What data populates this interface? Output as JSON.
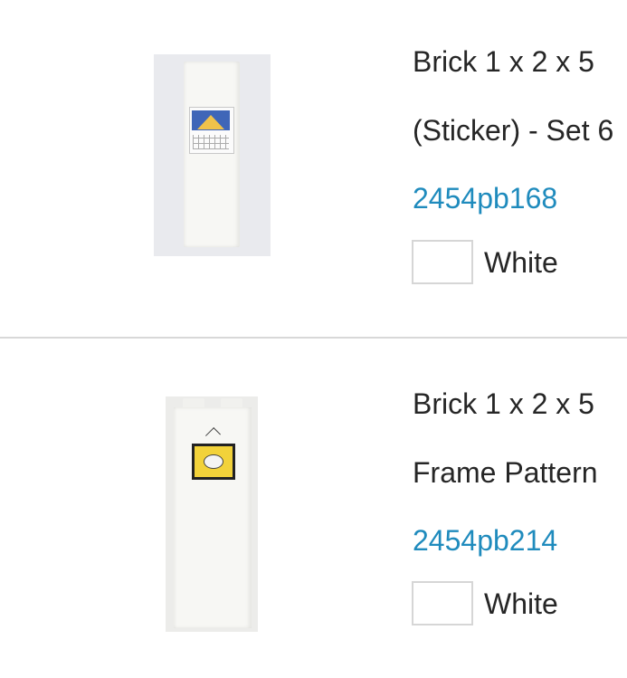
{
  "items": [
    {
      "title_line1": "Brick 1 x 2 x 5",
      "title_line2": "(Sticker) - Set 6",
      "part_number": "2454pb168",
      "color_name": "White",
      "swatch_color": "#ffffff"
    },
    {
      "title_line1": "Brick 1 x 2 x 5",
      "title_line2": "Frame Pattern",
      "part_number": "2454pb214",
      "color_name": "White",
      "swatch_color": "#ffffff"
    }
  ],
  "colors": {
    "link": "#1f8bbd",
    "text": "#262626",
    "divider": "#d8d8d8"
  }
}
